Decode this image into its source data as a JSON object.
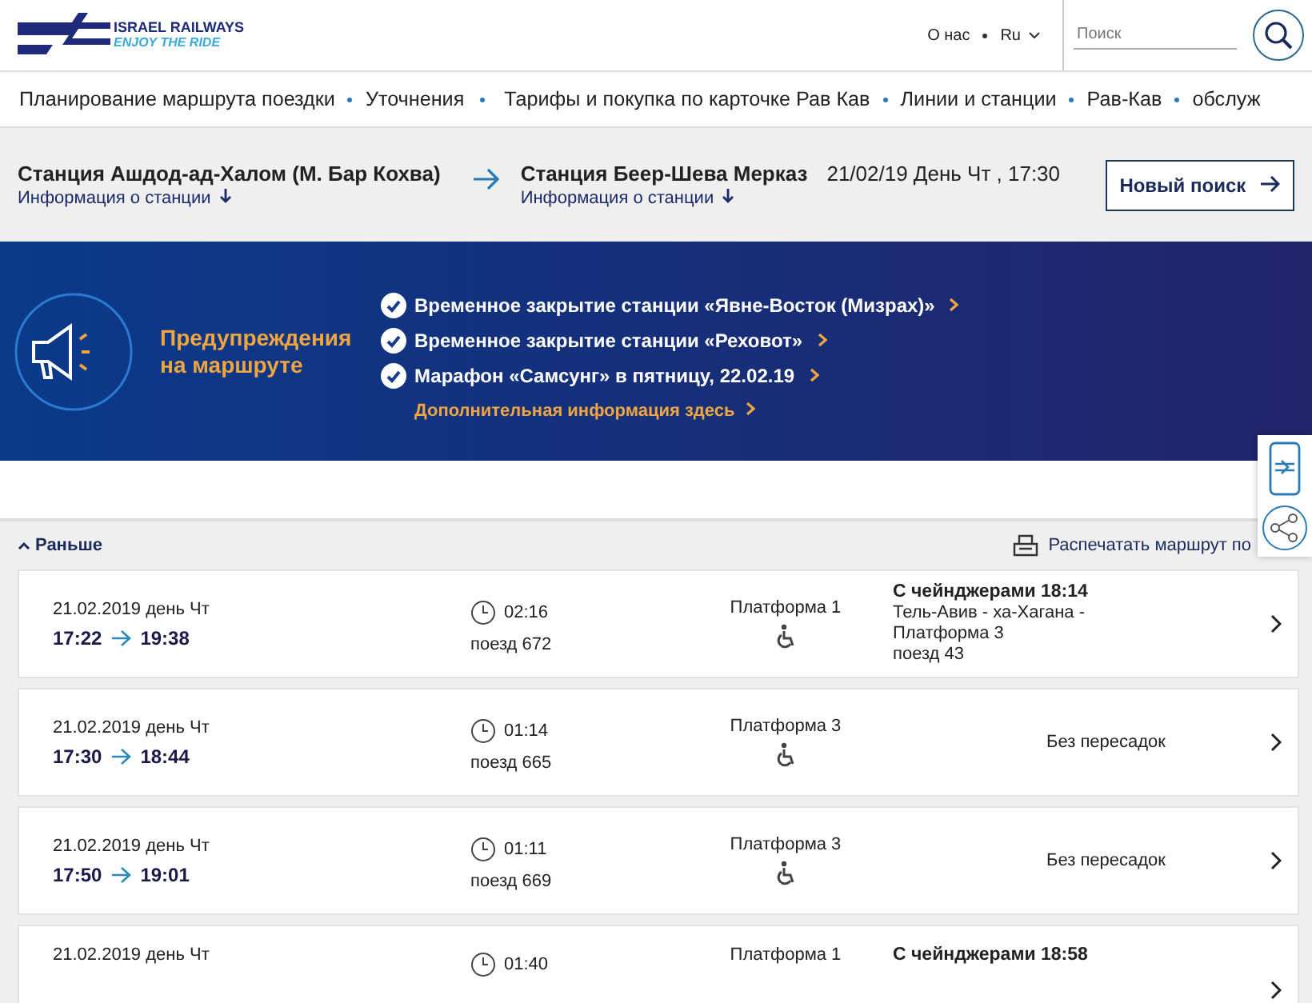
{
  "logo": {
    "title": "ISRAEL RAILWAYS",
    "tagline": "ENJOY THE RIDE"
  },
  "top_links": [
    {
      "label": "О нас"
    },
    {
      "label": "Ru",
      "dropdown": true
    }
  ],
  "search": {
    "placeholder": "Поиск"
  },
  "nav": [
    "Планирование маршрута поездки",
    "Уточнения",
    "Тарифы и покупка по карточке Рав Кав",
    "Линии и станции",
    "Рав-Кав",
    "обслуж"
  ],
  "route": {
    "from": {
      "name": "Станция Ашдод-ад-Халом (М. Бар Кохва)",
      "info": "Информация о станции"
    },
    "to": {
      "name": "Станция Беер-Шева Мерказ",
      "info": "Информация о станции"
    },
    "datetime": "21/02/19 День Чт , 17:30",
    "new_search": "Новый поиск"
  },
  "alerts": {
    "title": "Предупреждения на маршруте",
    "items": [
      "Временное закрытие станции «Явне-Восток (Мизрах)»",
      "Временное закрытие станции «Реховот»",
      "Марафон «Самсунг» в пятницу, 22.02.19"
    ],
    "more": "Дополнительная информация здесь"
  },
  "earlier": "Раньше",
  "print": "Распечатать маршрут по",
  "trips": [
    {
      "date": "21.02.2019 день Чт",
      "depart": "17:22",
      "arrive": "19:38",
      "duration": "02:16",
      "train": "поезд 672",
      "platform": "Платформа 1",
      "accessible": true,
      "kind": "transfer",
      "transfer": "С чейнджерами 18:14",
      "transfer_lines": [
        "Тель-Авив - ха-Хагана -",
        "Платформа 3",
        "поезд 43"
      ]
    },
    {
      "date": "21.02.2019 день Чт",
      "depart": "17:30",
      "arrive": "18:44",
      "duration": "01:14",
      "train": "поезд 665",
      "platform": "Платформа 3",
      "accessible": true,
      "kind": "direct",
      "transfer": "Без пересадок"
    },
    {
      "date": "21.02.2019 день Чт",
      "depart": "17:50",
      "arrive": "19:01",
      "duration": "01:11",
      "train": "поезд 669",
      "platform": "Платформа 3",
      "accessible": true,
      "kind": "direct",
      "transfer": "Без пересадок"
    },
    {
      "date": "21.02.2019 день Чт",
      "duration": "01:40",
      "platform": "Платформа 1",
      "kind": "transfer",
      "transfer": "С чейнджерами 18:58"
    }
  ]
}
